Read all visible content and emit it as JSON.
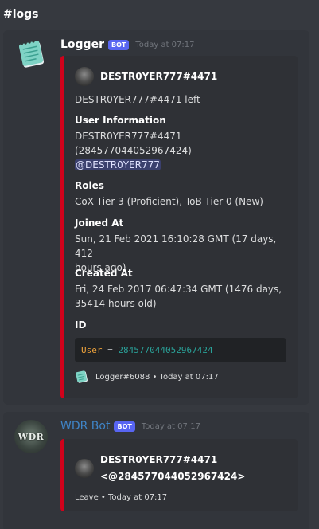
{
  "channel": {
    "title": "#logs"
  },
  "messages": [
    {
      "username": "Logger",
      "bot_tag": "BOT",
      "timestamp": "Today at 07:17",
      "embed": {
        "author_name": "DESTR0YER777#4471",
        "description": "DESTR0YER777#4471 left",
        "fields": [
          {
            "name": "User Information",
            "lines": [
              "DESTR0YER777#4471",
              "(284577044052967424)"
            ],
            "mention": "@DESTR0YER777"
          },
          {
            "name": "Roles",
            "value": "CoX Tier 3 (Proficient), ToB Tier 0 (New)"
          },
          {
            "name": "Joined At",
            "value_line1": "Sun, 21 Feb 2021 16:10:28 GMT (17 days, 412",
            "value_line2": "hours ago)"
          },
          {
            "name": "Created At",
            "value_line1": "Fri, 24 Feb 2017 06:47:34 GMT (1476 days,",
            "value_line2": "35414 hours old)"
          },
          {
            "name": "ID",
            "code": {
              "key": "User",
              "op": "=",
              "val": "284577044052967424"
            }
          }
        ],
        "footer": "Logger#6088 • Today at 07:17"
      }
    },
    {
      "username": "WDR Bot",
      "avatar_text": "WDR",
      "bot_tag": "BOT",
      "timestamp": "Today at 07:17",
      "embed": {
        "author_line1": "DESTR0YER777#4471",
        "author_line2": "<@284577044052967424>",
        "footer": "Leave • Today at 07:17"
      }
    }
  ],
  "colors": {
    "embed_bar": "#d0021b",
    "bot_tag": "#5865f2",
    "wdr_name": "#3f84c7"
  }
}
